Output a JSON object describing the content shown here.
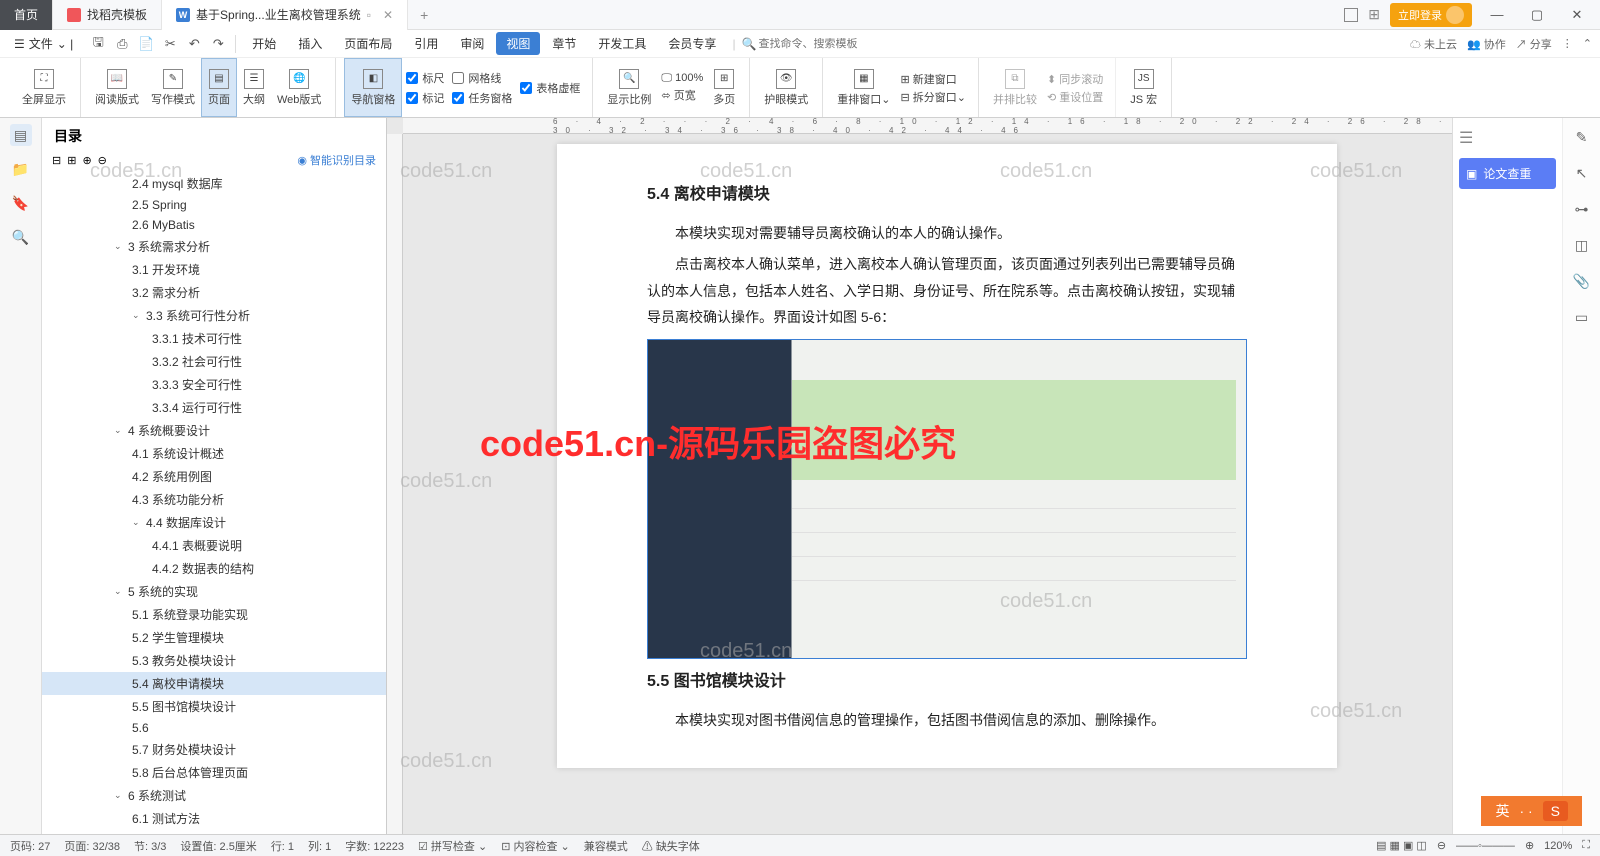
{
  "tabs": {
    "home": "首页",
    "template": "找稻壳模板",
    "active": "基于Spring...业生离校管理系统"
  },
  "login_btn": "立即登录",
  "file_menu": "文件",
  "menu": {
    "start": "开始",
    "insert": "插入",
    "layout": "页面布局",
    "reference": "引用",
    "review": "审阅",
    "view": "视图",
    "chapter": "章节",
    "dev": "开发工具",
    "vip": "会员专享"
  },
  "search_placeholder": "查找命令、搜索模板",
  "cloud": "未上云",
  "collab": "协作",
  "share": "分享",
  "ribbon": {
    "fullscreen": "全屏显示",
    "read": "阅读版式",
    "write": "写作模式",
    "page": "页面",
    "outline": "大纲",
    "web": "Web版式",
    "nav": "导航窗格",
    "ruler": "标尺",
    "grid": "网格线",
    "tableframe": "表格虚框",
    "mark": "标记",
    "taskpane": "任务窗格",
    "zoom": "显示比例",
    "pct": "100%",
    "pagewidth": "页宽",
    "multipage": "多页",
    "eyecare": "护眼模式",
    "rearrange": "重排窗口",
    "newwin": "新建窗口",
    "splitwin": "拆分窗口",
    "compare": "并排比较",
    "resetpos": "重设位置",
    "syncscroll": "同步滚动",
    "jsmacro": "JS 宏"
  },
  "outline_title": "目录",
  "outline_smart": "智能识别目录",
  "tree": [
    {
      "lvl": 3,
      "t": "2.4 mysql 数据库"
    },
    {
      "lvl": 3,
      "t": "2.5 Spring"
    },
    {
      "lvl": 3,
      "t": "2.6 MyBatis"
    },
    {
      "lvl": 2,
      "t": "3  系统需求分析",
      "exp": true
    },
    {
      "lvl": 3,
      "t": "3.1 开发环境"
    },
    {
      "lvl": 3,
      "t": "3.2 需求分析"
    },
    {
      "lvl": 3,
      "t": "3.3 系统可行性分析",
      "exp": true
    },
    {
      "lvl": 4,
      "t": "3.3.1 技术可行性"
    },
    {
      "lvl": 4,
      "t": "3.3.2 社会可行性"
    },
    {
      "lvl": 4,
      "t": "3.3.3 安全可行性"
    },
    {
      "lvl": 4,
      "t": "3.3.4 运行可行性"
    },
    {
      "lvl": 2,
      "t": "4  系统概要设计",
      "exp": true
    },
    {
      "lvl": 3,
      "t": "4.1 系统设计概述"
    },
    {
      "lvl": 3,
      "t": "4.2 系统用例图"
    },
    {
      "lvl": 3,
      "t": "4.3 系统功能分析"
    },
    {
      "lvl": 3,
      "t": "4.4 数据库设计",
      "exp": true
    },
    {
      "lvl": 4,
      "t": "4.4.1 表概要说明"
    },
    {
      "lvl": 4,
      "t": "4.4.2 数据表的结构"
    },
    {
      "lvl": 2,
      "t": "5  系统的实现",
      "exp": true
    },
    {
      "lvl": 3,
      "t": "5.1 系统登录功能实现"
    },
    {
      "lvl": 3,
      "t": "5.2 学生管理模块"
    },
    {
      "lvl": 3,
      "t": "5.3 教务处模块设计"
    },
    {
      "lvl": 3,
      "t": "5.4 离校申请模块",
      "sel": true
    },
    {
      "lvl": 3,
      "t": "5.5 图书馆模块设计"
    },
    {
      "lvl": 3,
      "t": "5.6"
    },
    {
      "lvl": 3,
      "t": "5.7 财务处模块设计"
    },
    {
      "lvl": 3,
      "t": "5.8 后台总体管理页面"
    },
    {
      "lvl": 2,
      "t": "6  系统测试",
      "exp": true
    },
    {
      "lvl": 3,
      "t": "6.1 测试方法"
    }
  ],
  "doc": {
    "h1": "5.4  离校申请模块",
    "p1": "本模块实现对需要辅导员离校确认的本人的确认操作。",
    "p2": "点击离校本人确认菜单，进入离校本人确认管理页面，该页面通过列表列出已需要辅导员确认的本人信息，包括本人姓名、入学日期、身份证号、所在院系等。点击离校确认按钮，实现辅导员离校确认操作。界面设计如图 5-6：",
    "h2": "5.5  图书馆模块设计",
    "p3": "本模块实现对图书借阅信息的管理操作，包括图书借阅信息的添加、删除操作。"
  },
  "right_panel": {
    "paper_check": "论文查重"
  },
  "status": {
    "page": "页码: 27",
    "pages": "页面: 32/38",
    "sec": "节: 3/3",
    "setval": "设置值: 2.5厘米",
    "row": "行: 1",
    "col": "列: 1",
    "words": "字数: 12223",
    "spell": "拼写检查",
    "content": "内容检查",
    "compat": "兼容模式",
    "missfont": "缺失字体",
    "zoom": "120%"
  },
  "ruler_marks": "6 · 4 · 2 · · · 2 · 4 · 6 · 8 · 10 · 12 · 14 · 16 · 18 · 20 · 22 · 24 · 26 · 28 · 30 · 32 · 34 · 36 · 38 · 40 · 42 · 44 · 46",
  "watermark_text": "code51.cn",
  "watermark_red": "code51.cn-源码乐园盗图必究",
  "ime_label": "英"
}
